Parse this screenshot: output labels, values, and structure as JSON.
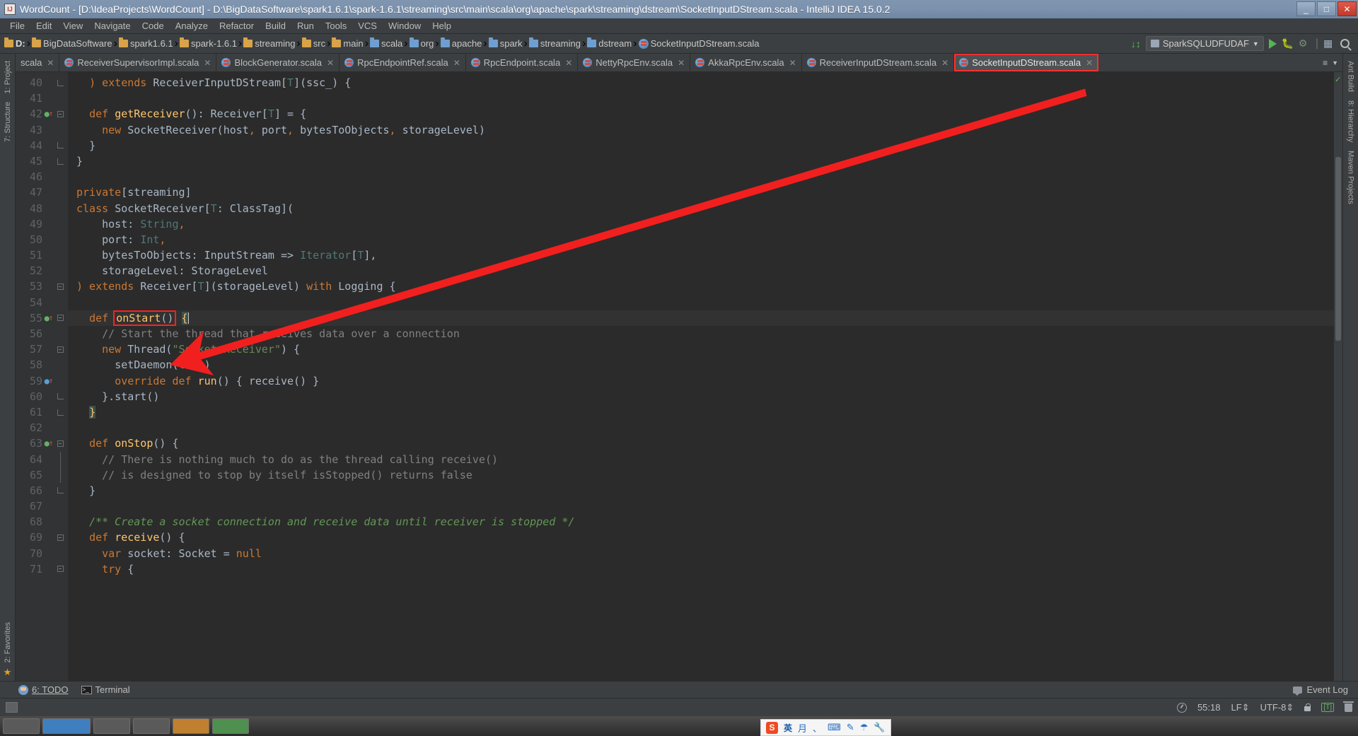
{
  "window": {
    "title": "WordCount - [D:\\IdeaProjects\\WordCount] - D:\\BigDataSoftware\\spark1.6.1\\spark-1.6.1\\streaming\\src\\main\\scala\\org\\apache\\spark\\streaming\\dstream\\SocketInputDStream.scala - IntelliJ IDEA 15.0.2",
    "app_icon": "intellij-idea-icon",
    "minimize": "_",
    "maximize": "□",
    "close": "✕"
  },
  "menubar": {
    "items": [
      "File",
      "Edit",
      "View",
      "Navigate",
      "Code",
      "Analyze",
      "Refactor",
      "Build",
      "Run",
      "Tools",
      "VCS",
      "Window",
      "Help"
    ]
  },
  "breadcrumb": {
    "items": [
      {
        "label": "D:",
        "icon": "folder-icon",
        "bold": true
      },
      {
        "label": "BigDataSoftware",
        "icon": "folder-icon",
        "bold": false
      },
      {
        "label": "spark1.6.1",
        "icon": "folder-icon",
        "bold": false
      },
      {
        "label": "spark-1.6.1",
        "icon": "folder-icon",
        "bold": false
      },
      {
        "label": "streaming",
        "icon": "folder-icon",
        "bold": false
      },
      {
        "label": "src",
        "icon": "folder-icon",
        "bold": false
      },
      {
        "label": "main",
        "icon": "folder-icon",
        "bold": false
      },
      {
        "label": "scala",
        "icon": "source-folder-icon",
        "bold": false
      },
      {
        "label": "org",
        "icon": "source-folder-icon",
        "bold": false
      },
      {
        "label": "apache",
        "icon": "source-folder-icon",
        "bold": false
      },
      {
        "label": "spark",
        "icon": "source-folder-icon",
        "bold": false
      },
      {
        "label": "streaming",
        "icon": "source-folder-icon",
        "bold": false
      },
      {
        "label": "dstream",
        "icon": "source-folder-icon",
        "bold": false
      },
      {
        "label": "SocketInputDStream.scala",
        "icon": "scala-file-icon",
        "bold": false
      }
    ]
  },
  "toolbar": {
    "sort_label": "↓↕",
    "run_config": "SparkSQLUDFUDAF",
    "dropdown_caret": "▼",
    "run_button": "run-button",
    "debug_button": "debug-button",
    "coverage_button": "run-with-coverage-button",
    "layout_button": "layout-button",
    "search_button": "search-everywhere-button"
  },
  "tabs": [
    {
      "label": "scala",
      "partial": true,
      "active": false,
      "highlighted": false
    },
    {
      "label": "ReceiverSupervisorImpl.scala",
      "partial": false,
      "active": false,
      "highlighted": false
    },
    {
      "label": "BlockGenerator.scala",
      "partial": false,
      "active": false,
      "highlighted": false
    },
    {
      "label": "RpcEndpointRef.scala",
      "partial": false,
      "active": false,
      "highlighted": false
    },
    {
      "label": "RpcEndpoint.scala",
      "partial": false,
      "active": false,
      "highlighted": false
    },
    {
      "label": "NettyRpcEnv.scala",
      "partial": false,
      "active": false,
      "highlighted": false
    },
    {
      "label": "AkkaRpcEnv.scala",
      "partial": false,
      "active": false,
      "highlighted": false
    },
    {
      "label": "ReceiverInputDStream.scala",
      "partial": false,
      "active": false,
      "highlighted": false
    },
    {
      "label": "SocketInputDStream.scala",
      "partial": false,
      "active": true,
      "highlighted": true
    }
  ],
  "left_rail": {
    "items": [
      "1: Project",
      "7: Structure",
      "2: Favorites"
    ]
  },
  "right_rail": {
    "items": [
      "Ant Build",
      "8: Hierarchy",
      "Maven Projects"
    ]
  },
  "editor": {
    "first_line": 40,
    "current_line": 55,
    "annotation": {
      "type": "red-arrow",
      "highlight_text": "onStart()"
    },
    "lines": [
      {
        "n": 40,
        "fold": "end",
        "marker": "",
        "html": "  <span class=\"k\">) extends</span> <span class=\"t\">ReceiverInputDStream[</span><span class=\"g\">T</span><span class=\"t\">](ssc_) {</span>"
      },
      {
        "n": 41,
        "fold": "",
        "marker": "",
        "html": ""
      },
      {
        "n": 42,
        "fold": "start",
        "marker": "override-green",
        "html": "  <span class=\"k\">def</span> <span class=\"fn\">getReceiver</span><span class=\"t\">(): Receiver[</span><span class=\"g\">T</span><span class=\"t\">] = {</span>"
      },
      {
        "n": 43,
        "fold": "",
        "marker": "",
        "html": "    <span class=\"k\">new</span> <span class=\"t\">SocketReceiver(host</span><span class=\"k\">,</span> <span class=\"t\">port</span><span class=\"k\">,</span> <span class=\"t\">bytesToObjects</span><span class=\"k\">,</span> <span class=\"t\">storageLevel)</span>"
      },
      {
        "n": 44,
        "fold": "end",
        "marker": "",
        "html": "  <span class=\"t\">}</span>"
      },
      {
        "n": 45,
        "fold": "end",
        "marker": "",
        "html": "<span class=\"t\">}</span>"
      },
      {
        "n": 46,
        "fold": "",
        "marker": "",
        "html": ""
      },
      {
        "n": 47,
        "fold": "",
        "marker": "",
        "html": "<span class=\"k\">private</span><span class=\"t\">[streaming]</span>"
      },
      {
        "n": 48,
        "fold": "",
        "marker": "",
        "html": "<span class=\"k\">class</span> <span class=\"t\">SocketReceiver[</span><span class=\"g\">T</span><span class=\"t\">: ClassTag](</span>"
      },
      {
        "n": 49,
        "fold": "",
        "marker": "",
        "html": "    <span class=\"t\">host: </span><span class=\"g\">String</span><span class=\"k\">,</span>"
      },
      {
        "n": 50,
        "fold": "",
        "marker": "",
        "html": "    <span class=\"t\">port: </span><span class=\"g\">Int</span><span class=\"k\">,</span>"
      },
      {
        "n": 51,
        "fold": "",
        "marker": "",
        "html": "    <span class=\"t\">bytesToObjects: InputStream =&gt; </span><span class=\"g\">Iterator</span><span class=\"t\">[</span><span class=\"g\">T</span><span class=\"t\">],</span>"
      },
      {
        "n": 52,
        "fold": "",
        "marker": "",
        "html": "    <span class=\"t\">storageLevel: StorageLevel</span>"
      },
      {
        "n": 53,
        "fold": "start",
        "marker": "",
        "html": "<span class=\"k\">) extends</span> <span class=\"t\">Receiver[</span><span class=\"g\">T</span><span class=\"t\">](storageLevel) </span><span class=\"k\">with</span> <span class=\"t\">Logging {</span>"
      },
      {
        "n": 54,
        "fold": "",
        "marker": "",
        "html": ""
      },
      {
        "n": 55,
        "fold": "start",
        "marker": "override-green",
        "current": true,
        "html": "  <span class=\"k\">def </span><span class=\"hl-onstart\"><span class=\"fn\">onStart</span><span class=\"t\">()</span></span> <span class=\"brace-hl\">{</span><span class=\"caret\"></span>"
      },
      {
        "n": 56,
        "fold": "",
        "marker": "",
        "html": "    <span class=\"cm\">// Start the thread that receives data over a connection</span>"
      },
      {
        "n": 57,
        "fold": "start",
        "marker": "",
        "html": "    <span class=\"k\">new</span> <span class=\"t\">Thread(</span><span class=\"s\">\"Socket Receiver\"</span><span class=\"t\">) {</span>"
      },
      {
        "n": 58,
        "fold": "",
        "marker": "",
        "html": "      <span class=\"t\">setDaemon(</span><span class=\"k\">true</span><span class=\"t\">)</span>"
      },
      {
        "n": 59,
        "fold": "",
        "marker": "override-blue",
        "html": "      <span class=\"k\">override def</span> <span class=\"fn\">run</span><span class=\"t\">() { receive() }</span>"
      },
      {
        "n": 60,
        "fold": "end",
        "marker": "",
        "html": "    <span class=\"t\">}.start()</span>"
      },
      {
        "n": 61,
        "fold": "end",
        "marker": "",
        "html": "  <span class=\"brace-hl\">}</span>"
      },
      {
        "n": 62,
        "fold": "",
        "marker": "",
        "html": ""
      },
      {
        "n": 63,
        "fold": "start",
        "marker": "override-green",
        "html": "  <span class=\"k\">def</span> <span class=\"fn\">onStop</span><span class=\"t\">() {</span>"
      },
      {
        "n": 64,
        "fold": "mid",
        "marker": "",
        "html": "    <span class=\"cm\">// There is nothing much to do as the thread calling receive()</span>"
      },
      {
        "n": 65,
        "fold": "mid",
        "marker": "",
        "html": "    <span class=\"cm\">// is designed to stop by itself isStopped() returns false</span>"
      },
      {
        "n": 66,
        "fold": "end",
        "marker": "",
        "html": "  <span class=\"t\">}</span>"
      },
      {
        "n": 67,
        "fold": "",
        "marker": "",
        "html": ""
      },
      {
        "n": 68,
        "fold": "",
        "marker": "",
        "html": "  <span class=\"dc\">/** Create a socket connection and receive data until receiver is stopped */</span>"
      },
      {
        "n": 69,
        "fold": "start",
        "marker": "",
        "html": "  <span class=\"k\">def</span> <span class=\"fn\">receive</span><span class=\"t\">() {</span>"
      },
      {
        "n": 70,
        "fold": "",
        "marker": "",
        "html": "    <span class=\"k\">var</span> <span class=\"t\">socket: Socket = </span><span class=\"k\">null</span>"
      },
      {
        "n": 71,
        "fold": "start",
        "marker": "",
        "html": "    <span class=\"k\">try</span> <span class=\"t\">{</span>"
      }
    ]
  },
  "tool_windows": {
    "todo": "6: TODO",
    "todo_num": "6",
    "terminal": "Terminal",
    "event_log": "Event Log"
  },
  "statusbar": {
    "caret_position": "55:18",
    "line_separator": "LF",
    "encoding": "UTF-8",
    "lock_icon": "read-write-lock-icon",
    "todo_badge": "[T]",
    "trash_icon": "trash-icon",
    "inspection_icon": "inspections-icon"
  },
  "ime_tray": {
    "logo": "S",
    "mode": "英",
    "items": [
      "月",
      "、",
      "⌨",
      "✎",
      "☂",
      "🔧"
    ]
  },
  "colors": {
    "accent_red": "#ff2020",
    "editor_bg": "#2b2b2b",
    "gutter_bg": "#313335",
    "chrome_bg": "#3c3f41",
    "keyword": "#cc7832",
    "string": "#6a8759",
    "comment": "#808080",
    "doc_comment": "#629755",
    "function": "#ffc66d",
    "type_generic": "#507874",
    "text": "#a9b7c6",
    "titlebar": "#7b91ad"
  }
}
